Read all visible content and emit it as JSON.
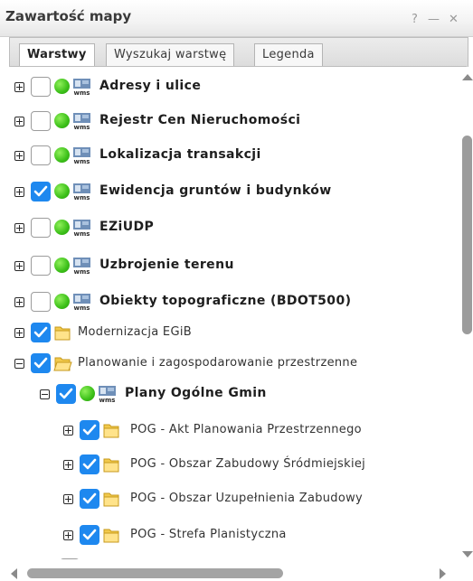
{
  "window": {
    "title": "Zawartość mapy",
    "help_label": "?",
    "minimize_label": "—",
    "close_label": "✕"
  },
  "tabs": [
    {
      "label": "Warstwy",
      "active": true
    },
    {
      "label": "Wyszukaj warstwę",
      "active": false
    },
    {
      "label": "Legenda",
      "active": false
    }
  ],
  "layers": [
    {
      "label": "Adresy i ulice",
      "checked": false,
      "type": "wms",
      "expanded": false
    },
    {
      "label": "Rejestr Cen Nieruchomości",
      "checked": false,
      "type": "wms",
      "expanded": false
    },
    {
      "label": "Lokalizacja transakcji",
      "checked": false,
      "type": "wms",
      "expanded": false
    },
    {
      "label": "Ewidencja gruntów i budynków",
      "checked": true,
      "type": "wms",
      "expanded": false
    },
    {
      "label": "EZiUDP",
      "checked": false,
      "type": "wms",
      "expanded": false
    },
    {
      "label": "Uzbrojenie terenu",
      "checked": false,
      "type": "wms",
      "expanded": false
    },
    {
      "label": "Obiekty topograficzne (BDOT500)",
      "checked": false,
      "type": "wms",
      "expanded": false
    },
    {
      "label": "Modernizacja EGiB",
      "checked": true,
      "type": "folder",
      "expanded": false
    },
    {
      "label": "Planowanie i zagospodarowanie przestrzenne",
      "checked": true,
      "type": "folder",
      "expanded": true
    },
    {
      "label": "Plany Ogólne Gmin",
      "checked": true,
      "type": "wms",
      "expanded": true
    },
    {
      "label": "POG - Akt Planowania Przestrzennego",
      "checked": true,
      "type": "folder",
      "expanded": false
    },
    {
      "label": "POG - Obszar Zabudowy Śródmiejskiej",
      "checked": true,
      "type": "folder",
      "expanded": false
    },
    {
      "label": "POG - Obszar Uzupełnienia Zabudowy",
      "checked": true,
      "type": "folder",
      "expanded": false
    },
    {
      "label": "POG - Strefa Planistyczna",
      "checked": true,
      "type": "folder",
      "expanded": false
    }
  ],
  "icons": {
    "wms_text": "wms",
    "status_color": "#3bbf18",
    "checkbox_checked_color": "#1e88ef",
    "folder_color": "#f2c94c"
  }
}
